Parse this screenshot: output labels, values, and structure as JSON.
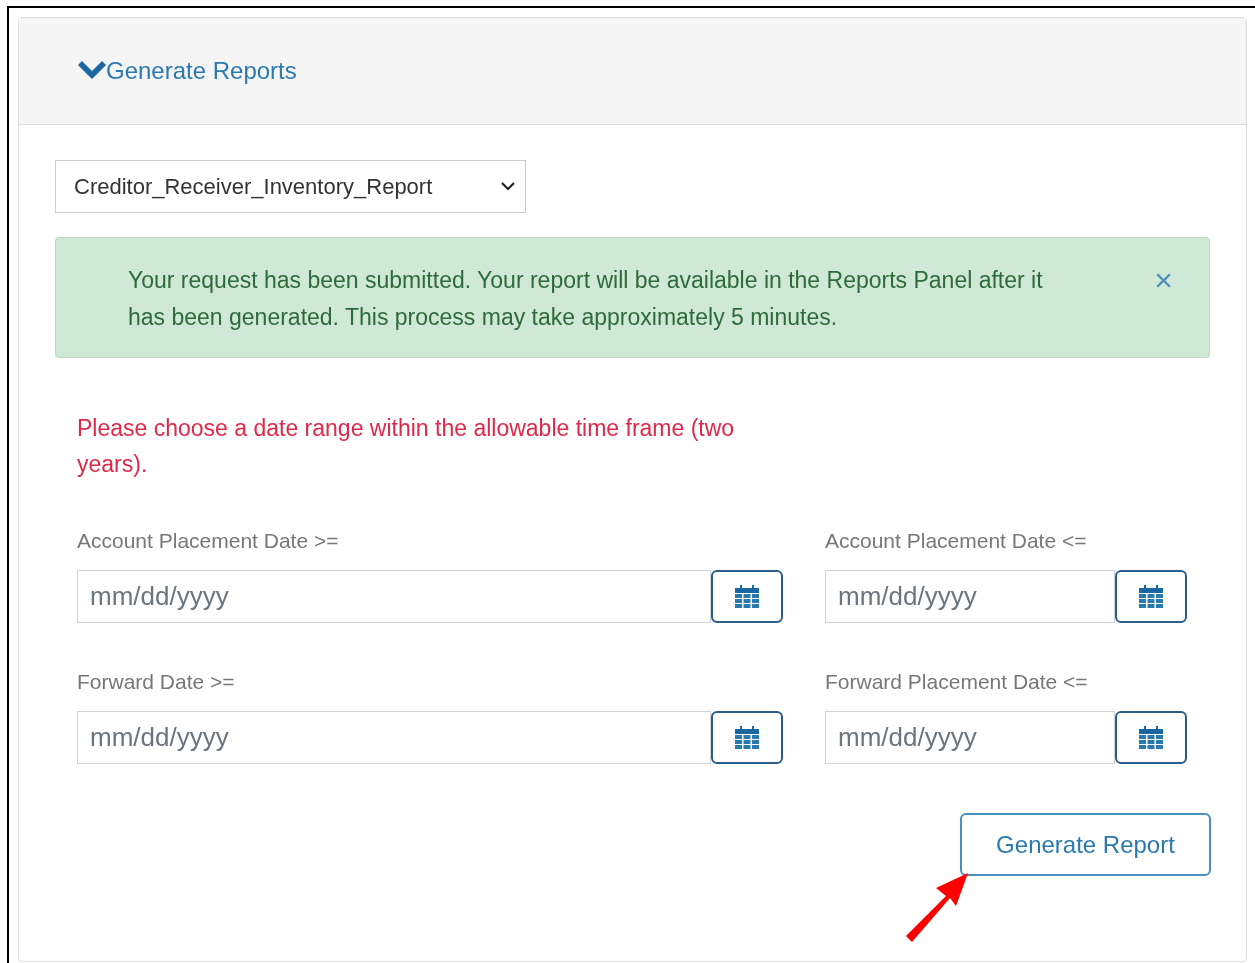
{
  "panel": {
    "title": "Generate Reports",
    "expanded": true
  },
  "report_select": {
    "value": "Creditor_Receiver_Inventory_Report"
  },
  "alert": {
    "message": "Your request has been submitted. Your report will be available in the Reports Panel after it has been generated. This process may take approximately 5 minutes.",
    "close": "×"
  },
  "error": "Please choose a date range within the allowable time frame (two years).",
  "date_fields": [
    {
      "label": "Account Placement Date >=",
      "placeholder": "mm/dd/yyyy"
    },
    {
      "label": "Account Placement Date <=",
      "placeholder": "mm/dd/yyyy"
    },
    {
      "label": "Forward Date >=",
      "placeholder": "mm/dd/yyyy"
    },
    {
      "label": "Forward Placement Date <=",
      "placeholder": "mm/dd/yyyy"
    }
  ],
  "submit_button": "Generate Report"
}
